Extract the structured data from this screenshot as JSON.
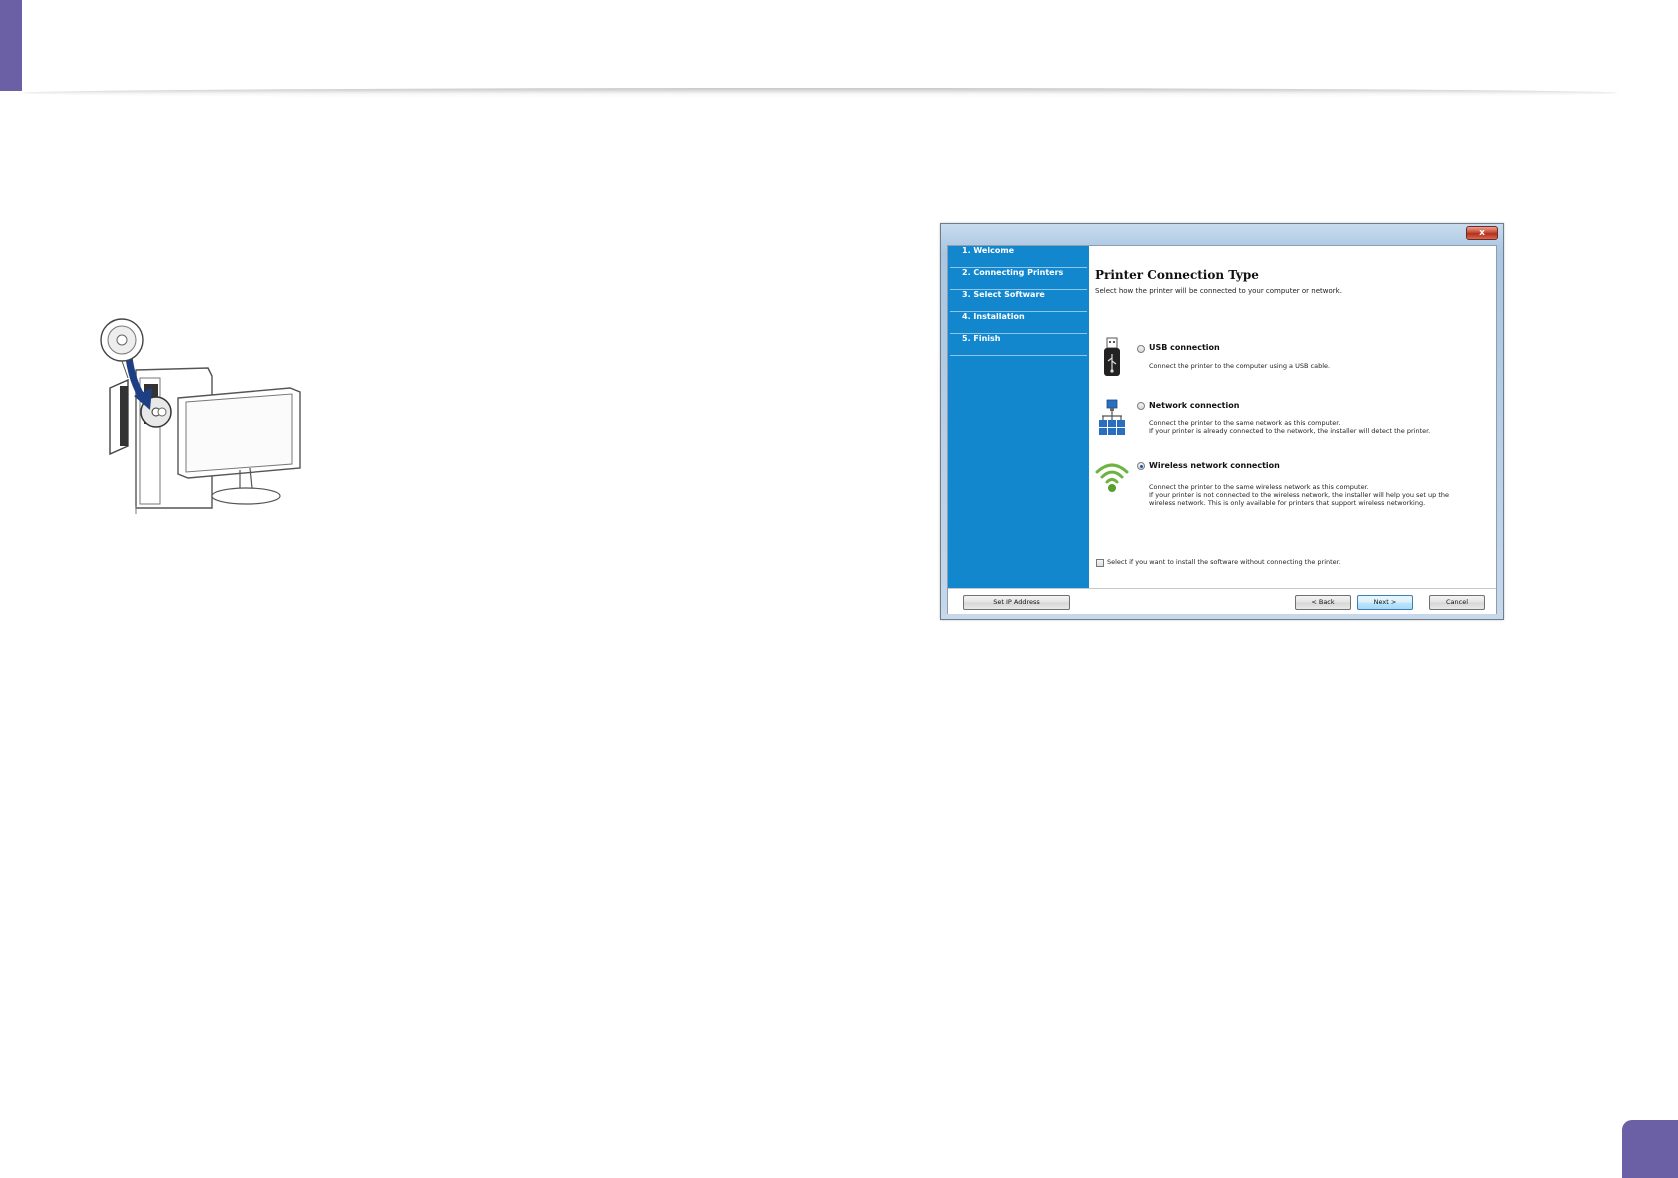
{
  "dialog": {
    "close_glyph": "x",
    "steps": [
      "1. Welcome",
      "2. Connecting Printers",
      "3. Select Software",
      "4. Installation",
      "5. Finish"
    ],
    "title": "Printer Connection Type",
    "subtitle": "Select how the printer will be connected to your computer or network.",
    "options": [
      {
        "icon": "usb-icon",
        "label": "USB connection",
        "selected": false,
        "desc": [
          "Connect the printer to the computer using a USB cable."
        ]
      },
      {
        "icon": "network-icon",
        "label": "Network connection",
        "selected": false,
        "desc": [
          "Connect the printer to the same network as this computer.",
          "If your printer is already connected to the network, the installer will detect the printer."
        ]
      },
      {
        "icon": "wireless-icon",
        "label": "Wireless network connection",
        "selected": true,
        "desc": [
          "Connect the printer to the same wireless network as this computer.",
          "If your printer is not connected to the wireless network, the installer will help you set up the",
          "wireless network. This is only available for printers that support wireless networking."
        ]
      }
    ],
    "no_connect_checkbox": {
      "checked": false,
      "label": "Select if you want to install the software without connecting the printer."
    },
    "buttons": {
      "set_ip": "Set IP Address",
      "back": "< Back",
      "next": "Next >",
      "cancel": "Cancel"
    }
  },
  "colors": {
    "accent": "#6b5fa5",
    "steps_panel": "#1287ce",
    "wifi_green": "#6db33f"
  }
}
